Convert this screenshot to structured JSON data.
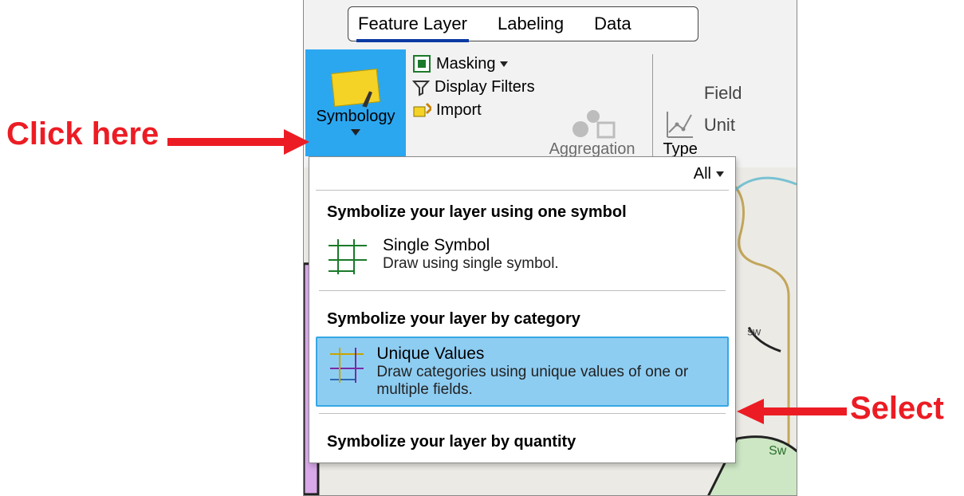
{
  "tabs": {
    "feature_layer": "Feature Layer",
    "labeling": "Labeling",
    "data": "Data"
  },
  "ribbon": {
    "symbology_label": "Symbology",
    "masking": "Masking",
    "display_filters": "Display Filters",
    "import": "Import",
    "aggregation": "Aggregation",
    "type": "Type",
    "fields": "Field",
    "units": "Unit"
  },
  "dropdown": {
    "filter": "All",
    "section_one_symbol": "Symbolize your layer using one symbol",
    "single_symbol": {
      "title": "Single Symbol",
      "desc": "Draw using single symbol."
    },
    "section_category": "Symbolize your layer by category",
    "unique_values": {
      "title": "Unique Values",
      "desc": "Draw categories using unique values of one or multiple fields."
    },
    "section_quantity": "Symbolize your layer by quantity"
  },
  "annotations": {
    "click_here": "Click here",
    "select": "Select"
  }
}
